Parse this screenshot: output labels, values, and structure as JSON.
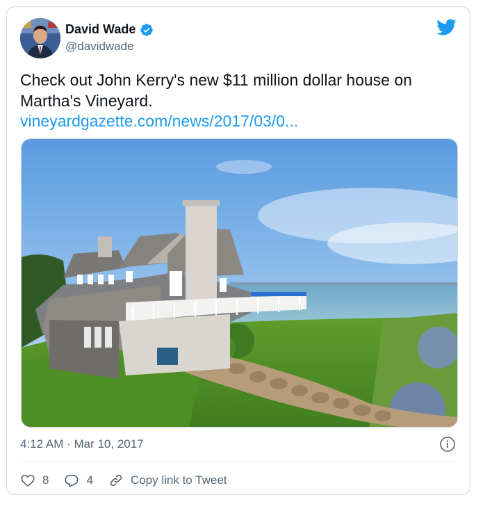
{
  "author": {
    "name": "David Wade",
    "handle": "@davidwade",
    "verified": true
  },
  "tweet": {
    "text": "Check out John Kerry's new $11 million dollar house on Martha's Vineyard.",
    "link_text": "vineyardgazette.com/news/2017/03/0...",
    "timestamp": "4:12 AM · Mar 10, 2017"
  },
  "actions": {
    "likes": "8",
    "replies": "4",
    "copy_link_label": "Copy link to Tweet"
  },
  "icons": {
    "brand": "twitter-bird-icon",
    "verified": "verified-badge-icon",
    "info": "info-icon",
    "like": "heart-icon",
    "reply": "reply-bubble-icon",
    "link": "link-icon"
  },
  "colors": {
    "accent": "#1d9bf0",
    "text": "#0f1419",
    "secondary": "#536471",
    "border": "#cfd9de"
  }
}
